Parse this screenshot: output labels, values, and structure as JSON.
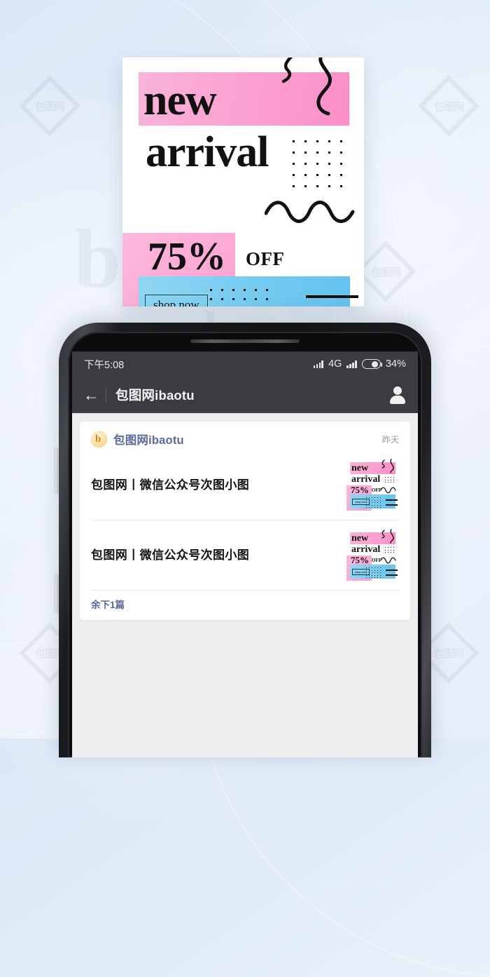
{
  "poster": {
    "heading_line1": "new",
    "heading_line2": "arrival",
    "discount": "75%",
    "discount_suffix": "OFF",
    "cta_label": "shop now",
    "colors": {
      "pink": "#fb9fd0",
      "blue": "#72c9ef",
      "ink": "#111111"
    }
  },
  "phone": {
    "statusbar": {
      "time": "下午5:08",
      "network": "4G",
      "battery_percent": "34%"
    },
    "navbar": {
      "back_icon": "back-arrow-icon",
      "title": "包图网ibaotu",
      "profile_icon": "user-avatar-icon"
    },
    "chat": {
      "account_name": "包图网ibaotu",
      "timestamp": "昨天",
      "articles": [
        {
          "title": "包图网丨微信公众号次图小图"
        },
        {
          "title": "包图网丨微信公众号次图小图"
        }
      ],
      "more_link": "余下1篇",
      "thumbnail": {
        "heading_line1": "new",
        "heading_line2": "arrival",
        "discount": "75%",
        "discount_suffix": "OFF",
        "cta_label": "shop now"
      }
    }
  },
  "watermark": {
    "text": "包图网"
  }
}
